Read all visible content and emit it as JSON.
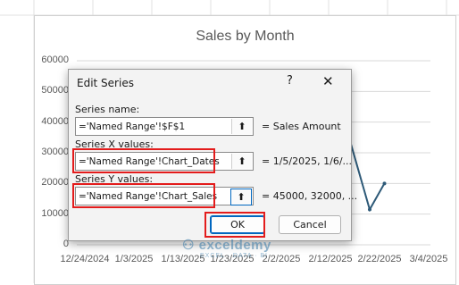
{
  "chart_data": {
    "type": "line",
    "title": "Sales by Month",
    "y_ticks": [
      "60000",
      "50000",
      "40000",
      "30000",
      "20000",
      "10000",
      "0"
    ],
    "x_ticks": [
      "12/24/2024",
      "1/3/2025",
      "1/13/2025",
      "1/23/2025",
      "2/2/2025",
      "2/12/2025",
      "2/22/2025",
      "3/4/2025"
    ],
    "ylim": [
      0,
      60000
    ],
    "visible_points": [
      {
        "x": "2/14/2025",
        "y": 45000
      },
      {
        "x": "2/20/2025",
        "y": 11500
      },
      {
        "x": "2/23/2025",
        "y": 20000
      }
    ],
    "line_color": "#2e5a78"
  },
  "dialog": {
    "title": "Edit Series",
    "help_label": "?",
    "close_label": "✕",
    "series_name_label": "Series name:",
    "series_name_value": "='Named Range'!$F$1",
    "series_name_preview": "= Sales Amount",
    "x_values_label": "Series X values:",
    "x_values_value": "='Named Range'!Chart_Dates",
    "x_values_preview": "= 1/5/2025, 1/6/...",
    "y_values_label": "Series Y values:",
    "y_values_value": "='Named Range'!Chart_Sales",
    "y_values_preview": "= 45000, 32000, ...",
    "ok_label": "OK",
    "cancel_label": "Cancel",
    "ref_icon": "collapse-dialog-icon"
  },
  "watermark": {
    "text": "exceldemy",
    "tag": "EXCEL · DATA · BI"
  },
  "colors": {
    "highlight": "#e31c1c",
    "accent": "#0067c0"
  }
}
